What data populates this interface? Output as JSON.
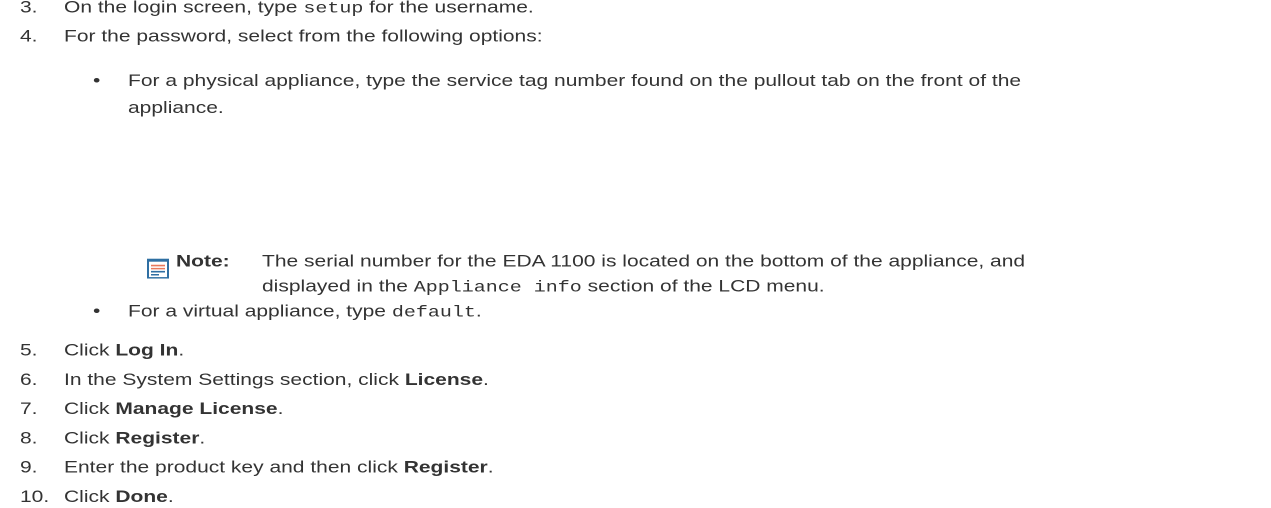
{
  "steps": [
    {
      "num": "3.",
      "pre": "On the login screen, type ",
      "code": "setup",
      "post": " for the username."
    },
    {
      "num": "4.",
      "text": "For the password, select from the following options:"
    },
    {
      "num": "5.",
      "pre": "Click ",
      "bold": "Log In",
      "post": "."
    },
    {
      "num": "6.",
      "pre": "In the System Settings section, click ",
      "bold": "License",
      "post": "."
    },
    {
      "num": "7.",
      "pre": "Click ",
      "bold": "Manage License",
      "post": "."
    },
    {
      "num": "8.",
      "pre": "Click ",
      "bold": "Register",
      "post": "."
    },
    {
      "num": "9.",
      "pre": "Enter the product key and then click ",
      "bold": "Register",
      "post": "."
    },
    {
      "num": "10.",
      "pre": "Click ",
      "bold": "Done",
      "post": "."
    }
  ],
  "bullets": [
    {
      "line1": "For a physical appliance, type the service tag number found on the pullout tab on the front of the",
      "line2": "appliance."
    },
    {
      "pre": "For a virtual appliance, type ",
      "code": "default",
      "post": "."
    }
  ],
  "bullet_glyph": "•",
  "note": {
    "label": "Note:",
    "line1": "The serial number for the EDA 1100 is located on the bottom of the appliance, and",
    "line2_pre": "displayed in the ",
    "line2_code": "Appliance info",
    "line2_post": " section of the LCD menu."
  },
  "icon": {
    "name": "note-icon",
    "accent": "#e8795c",
    "frame": "#2f6fa3"
  }
}
